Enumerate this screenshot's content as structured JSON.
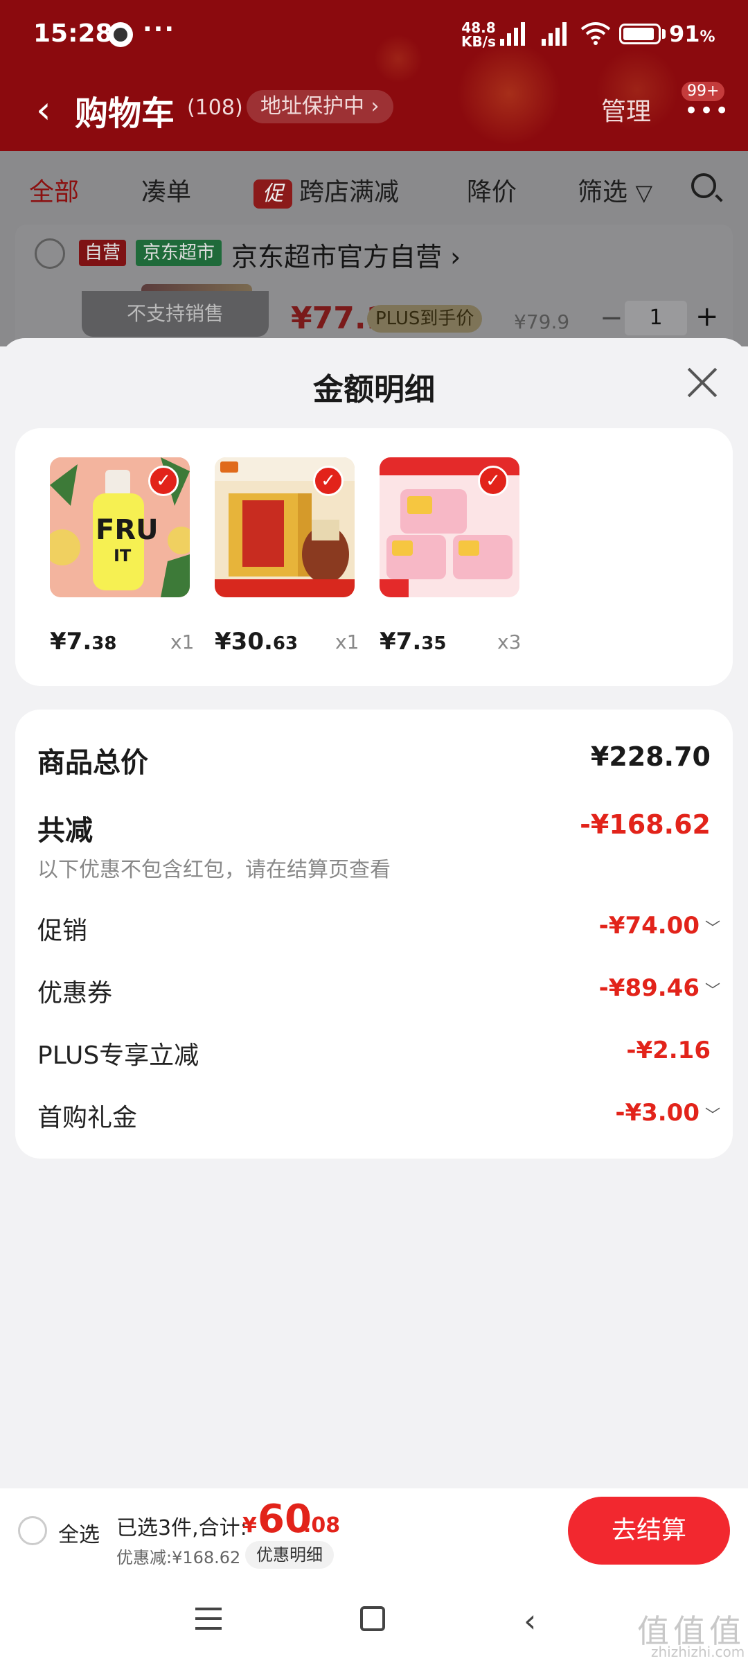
{
  "status_bar": {
    "time": "15:28",
    "more": "···",
    "net_speed_value": "48.8",
    "net_speed_unit": "KB/s",
    "battery": "91",
    "battery_unit": "%"
  },
  "header": {
    "back_icon": "chevron-left-icon",
    "title": "购物车",
    "count": "(108)",
    "address_protect": "地址保护中 ›",
    "manage": "管理",
    "more_badge": "99+"
  },
  "tabs": [
    {
      "label": "全部",
      "active": true
    },
    {
      "label": "凑单"
    },
    {
      "label": "跨店满减",
      "badge": "促"
    },
    {
      "label": "降价"
    },
    {
      "label": "筛选"
    }
  ],
  "cart_preview": {
    "tag_self": "自营",
    "tag_market": "京东超市",
    "shop_name": "京东超市官方自营 ›",
    "unsupported": "不支持销售",
    "price": "¥77.1",
    "plus_tag": "PLUS到手价",
    "original_price": "¥79.9",
    "minus": "−",
    "quantity": "1",
    "plus": "+"
  },
  "sheet": {
    "title": "金额明细",
    "close_icon": "close-icon",
    "products": [
      {
        "price_int": "¥7.",
        "price_dec": "38",
        "qty": "x1",
        "image": "fruit-wine-bottle"
      },
      {
        "price_int": "¥30.",
        "price_dec": "63",
        "qty": "x1",
        "image": "chinese-liquor-giftbox"
      },
      {
        "price_int": "¥7.",
        "price_dec": "35",
        "qty": "x3",
        "image": "liby-laundry-pods"
      }
    ],
    "summary": {
      "total_label": "商品总价",
      "total_value": "¥228.70",
      "reduce_label": "共减",
      "reduce_value": "-¥168.62",
      "note": "以下优惠不包含红包，请在结算页查看",
      "rows": [
        {
          "label": "促销",
          "value": "-¥74.00",
          "chevron": true
        },
        {
          "label": "优惠券",
          "value": "-¥89.46",
          "chevron": true
        },
        {
          "label": "PLUS专享立减",
          "value": "-¥2.16",
          "chevron": false
        },
        {
          "label": "首购礼金",
          "value": "-¥3.00",
          "chevron": true
        }
      ]
    }
  },
  "checkout": {
    "select_all": "全选",
    "selected_summary": "已选3件,合计:",
    "total_yen": "¥",
    "total_int": "60",
    "total_dec": ".08",
    "discount_line": "优惠减:¥168.62",
    "detail_pill": "优惠明细",
    "checkout_button": "去结算"
  },
  "watermark": {
    "text": "值值值",
    "sub": "zhizhizhi.com"
  },
  "colors": {
    "accent_red": "#e2231a",
    "header_dim": "#8b0a0e",
    "checkout_btn": "#f2282f"
  }
}
